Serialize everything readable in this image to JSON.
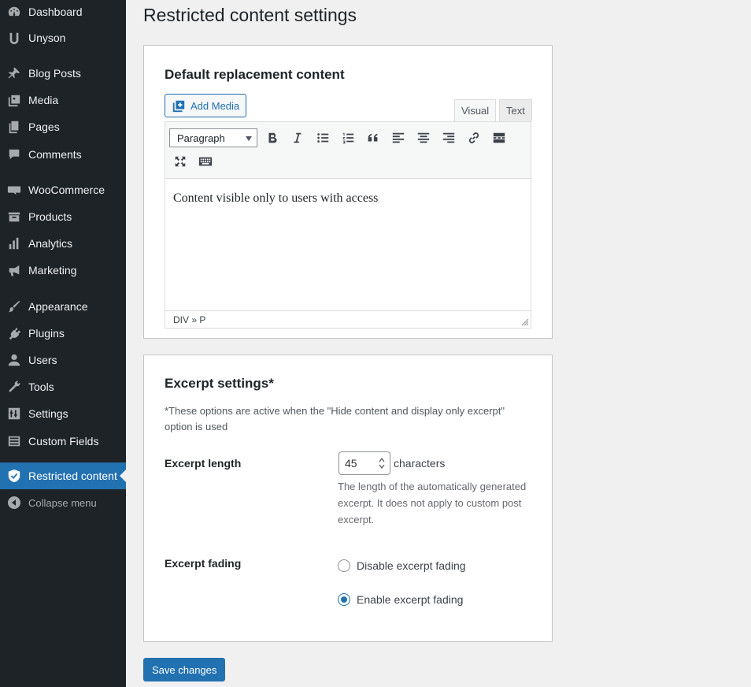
{
  "sidebar": {
    "items": [
      {
        "label": "Dashboard",
        "icon": "dashboard-icon"
      },
      {
        "label": "Unyson",
        "icon": "unyson-icon"
      },
      {
        "label": "Blog Posts",
        "icon": "pin-icon"
      },
      {
        "label": "Media",
        "icon": "media-icon"
      },
      {
        "label": "Pages",
        "icon": "pages-icon"
      },
      {
        "label": "Comments",
        "icon": "comments-icon"
      },
      {
        "label": "WooCommerce",
        "icon": "woocommerce-icon"
      },
      {
        "label": "Products",
        "icon": "products-icon"
      },
      {
        "label": "Analytics",
        "icon": "analytics-icon"
      },
      {
        "label": "Marketing",
        "icon": "megaphone-icon"
      },
      {
        "label": "Appearance",
        "icon": "brush-icon"
      },
      {
        "label": "Plugins",
        "icon": "plugin-icon"
      },
      {
        "label": "Users",
        "icon": "users-icon"
      },
      {
        "label": "Tools",
        "icon": "wrench-icon"
      },
      {
        "label": "Settings",
        "icon": "settings-icon"
      },
      {
        "label": "Custom Fields",
        "icon": "custom-fields-icon"
      },
      {
        "label": "Restricted content",
        "icon": "shield-icon",
        "active": true
      }
    ],
    "collapse_label": "Collapse menu"
  },
  "page": {
    "title": "Restricted content settings"
  },
  "editor_panel": {
    "heading": "Default replacement content",
    "add_media_label": "Add Media",
    "tab_visual": "Visual",
    "tab_text": "Text",
    "format_select": "Paragraph",
    "content": "Content visible only to users with access",
    "status_path": "DIV » P"
  },
  "excerpt_panel": {
    "heading": "Excerpt settings*",
    "note": "*These options are active when the \"Hide content and display only excerpt\" option is used",
    "length_label": "Excerpt length",
    "length_value": "45",
    "length_unit": "characters",
    "length_description": "The length of the automatically generated excerpt. It does not apply to custom post excerpt.",
    "fading_label": "Excerpt fading",
    "fading_options": [
      {
        "label": "Disable excerpt fading",
        "checked": false
      },
      {
        "label": "Enable excerpt fading",
        "checked": true
      }
    ]
  },
  "save_label": "Save changes",
  "colors": {
    "sidebar_bg": "#1d2327",
    "accent": "#2271b1",
    "page_bg": "#f0f0f1"
  }
}
